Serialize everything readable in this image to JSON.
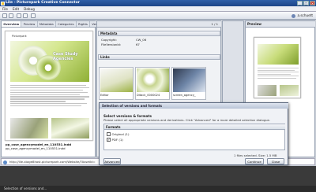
{
  "window": {
    "title": "Lile - Picturepark Creative Connector",
    "buttons": [
      "_",
      "□",
      "×"
    ]
  },
  "menu": [
    "File",
    "Edit",
    "Debug"
  ],
  "user": "a.schuett",
  "tabs": [
    "Overview",
    "Preview",
    "Metadata",
    "Categories",
    "Rights",
    "Versions",
    "Statistics"
  ],
  "document": {
    "header_text": "Picturepark",
    "hero_title": "Case Study Agencies",
    "filename_bold": "pp_case_agencymodel_en_110531.indd",
    "filename": "pp_case_agencymodel_en_110531.indd"
  },
  "mid": {
    "page_indicator": "1 / 1",
    "metadata_title": "Metadata",
    "metadata": [
      {
        "key": "Copyright:",
        "value": "CW_06"
      },
      {
        "key": "FileVersionId:",
        "value": "67"
      }
    ],
    "links_title": "Links",
    "links": [
      "Editor",
      "Ditack_0000024",
      "screen_agency_"
    ]
  },
  "preview": {
    "title": "Preview"
  },
  "urlbar": {
    "url": "http://lile-stage8host.picturepark.com/Website/?AssetId="
  },
  "dialog": {
    "title": "Selection of versions and formats",
    "heading": "Select versions & formats",
    "description": "Please select all appropriate versions and derivatives. Click \"Advanced\" for a more detailed selection dialogue.",
    "formats_header": "Formats",
    "formats": [
      {
        "label": "Original (1)",
        "checked": false
      },
      {
        "label": "PDF (1)",
        "checked": true
      }
    ],
    "selection_count": "1 files selected. Size: 1.5 MB",
    "advanced_label": "Advanced",
    "continue_label": "Continue",
    "close_label": "Close"
  },
  "status_bar": "Selection of versions and..."
}
